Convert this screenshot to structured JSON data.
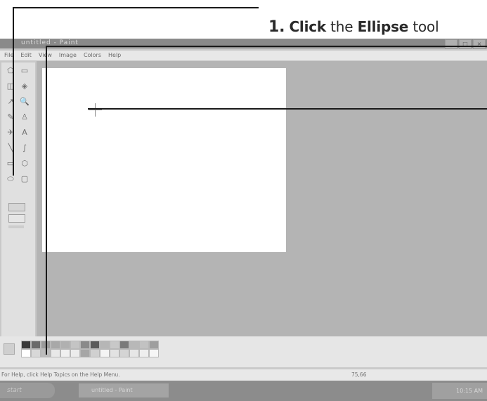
{
  "callout": {
    "step": "1.",
    "action": "Click",
    "mid": "the",
    "target": "Ellipse",
    "end": "tool"
  },
  "window": {
    "title": "untitled - Paint",
    "buttons": [
      "_",
      "□",
      "×"
    ]
  },
  "menu": [
    "File",
    "Edit",
    "View",
    "Image",
    "Colors",
    "Help"
  ],
  "tools": [
    {
      "name": "free-select-icon",
      "glyph": "⬠"
    },
    {
      "name": "select-icon",
      "glyph": "▭"
    },
    {
      "name": "eraser-icon",
      "glyph": "◫"
    },
    {
      "name": "fill-icon",
      "glyph": "◈"
    },
    {
      "name": "pick-color-icon",
      "glyph": "↗"
    },
    {
      "name": "magnifier-icon",
      "glyph": "🔍"
    },
    {
      "name": "pencil-icon",
      "glyph": "✎"
    },
    {
      "name": "brush-icon",
      "glyph": "♙"
    },
    {
      "name": "airbrush-icon",
      "glyph": "✈"
    },
    {
      "name": "text-icon",
      "glyph": "A"
    },
    {
      "name": "line-icon",
      "glyph": "╲"
    },
    {
      "name": "curve-icon",
      "glyph": "∫"
    },
    {
      "name": "rectangle-icon",
      "glyph": "▭"
    },
    {
      "name": "polygon-icon",
      "glyph": "⬡"
    },
    {
      "name": "ellipse-icon",
      "glyph": "⬭"
    },
    {
      "name": "rounded-rect-icon",
      "glyph": "▢"
    }
  ],
  "palette": [
    "#3a3a3a",
    "#6a6a6a",
    "#9a9a9a",
    "#a8a8a8",
    "#b0b0b0",
    "#c4c4c4",
    "#8a8a8a",
    "#5a5a5a",
    "#b6b6b6",
    "#c8c8c8",
    "#7a7a7a",
    "#b8b8b8",
    "#c2c2c2",
    "#9e9e9e",
    "#ffffff",
    "#d8d8d8",
    "#bcbcbc",
    "#e8e8e8",
    "#f0f0f0",
    "#ececec",
    "#a6a6a6",
    "#d0d0d0",
    "#f4f4f4",
    "#e2e2e2",
    "#d4d4d4",
    "#e6e6e6",
    "#eeeeee",
    "#f6f6f6"
  ],
  "status": {
    "help": "For Help, click Help Topics on the Help Menu.",
    "coords": "75,66"
  },
  "taskbar": {
    "start": "start",
    "task": "untitled - Paint",
    "tray": "10:15 AM"
  }
}
